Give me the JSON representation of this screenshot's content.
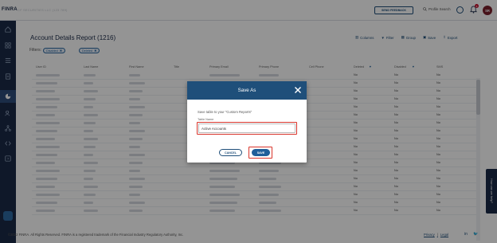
{
  "topbar": {
    "brand": "FINRA",
    "brand_subtitle": "CF SECURITIES LLC (123 789)",
    "send_feedback_label": "SEND FEEDBACK",
    "profile_search_label": "Profile Search",
    "notifications_count": "8",
    "avatar_initials": "SR"
  },
  "page": {
    "title": "Account Details Report (1216)",
    "toolbar": {
      "columns_label": "Columns",
      "filter_label": "Filter",
      "group_label": "Group",
      "save_label": "Save",
      "export_label": "Export"
    },
    "filters_label": "Filters:",
    "filter_chips": [
      "Disabled",
      "Deleted"
    ],
    "columns": [
      "User ID",
      "Last Name",
      "First Name",
      "Title",
      "Primary Email",
      "Primary Phone",
      "Cell Phone",
      "Deleted",
      "Disabled",
      "SMS"
    ],
    "row_values": {
      "deleted": "No",
      "disabled": "No",
      "sms": "No"
    },
    "row_count": 18,
    "help_tab_label": "How can we help?"
  },
  "footer": {
    "copyright": "©2022 FINRA. All Rights Reserved. FINRA is a registered trademark of the Financial Industry Regulatory Authority, Inc.",
    "privacy_label": "Privacy",
    "legal_label": "Legal"
  },
  "modal": {
    "title": "Save As",
    "description": "Save table to your \"Custom Reports\"",
    "field_label": "Table Name",
    "field_value": "Active Accounts",
    "cancel_label": "CANCEL",
    "save_label": "SAVE"
  },
  "colors": {
    "navy": "#1b2a47",
    "primary_blue": "#1f4f7a",
    "highlight_red": "#d9342b"
  }
}
